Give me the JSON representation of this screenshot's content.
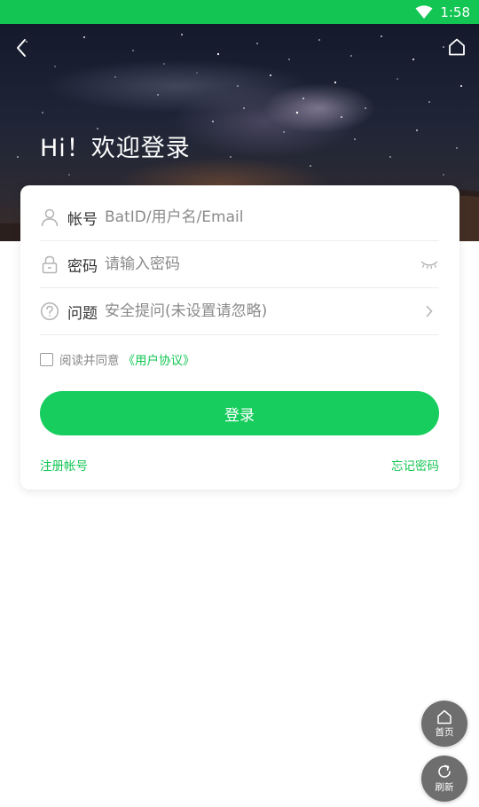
{
  "status_bar": {
    "time": "1:58"
  },
  "header": {
    "title": "Hi！欢迎登录"
  },
  "form": {
    "account": {
      "label": "帐号",
      "placeholder": "BatID/用户名/Email"
    },
    "password": {
      "label": "密码",
      "placeholder": "请输入密码"
    },
    "question": {
      "label": "问题",
      "placeholder": "安全提问(未设置请忽略)"
    },
    "agree": {
      "text": "阅读并同意",
      "link": "《用户协议》",
      "checked": false
    },
    "login_label": "登录",
    "register_label": "注册帐号",
    "forgot_label": "忘记密码"
  },
  "floating": {
    "home_label": "首页",
    "refresh_label": "刷新"
  },
  "colors": {
    "accent": "#13c653",
    "button": "#17cd5d",
    "float_bg": "#6e6e6e"
  },
  "icons": [
    "wifi-icon",
    "back-arrow-icon",
    "home-icon",
    "user-icon",
    "lock-icon",
    "question-icon",
    "eye-closed-icon",
    "chevron-right-icon",
    "refresh-icon"
  ]
}
